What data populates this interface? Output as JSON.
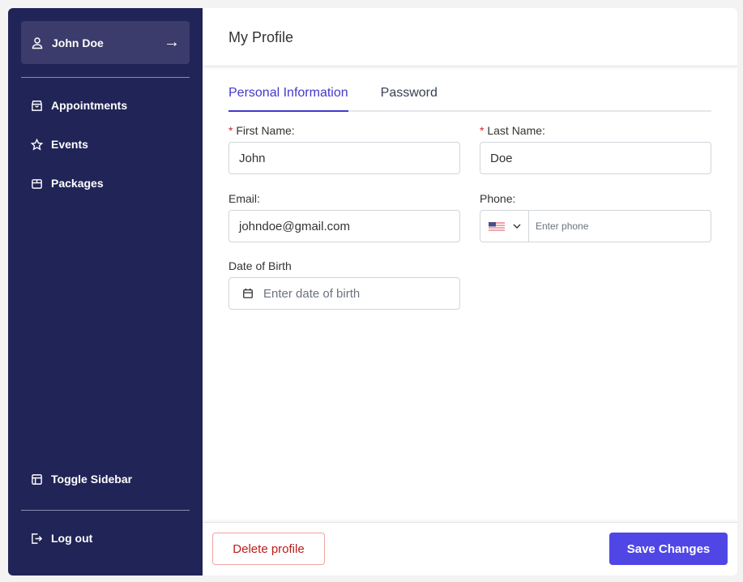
{
  "sidebar": {
    "user": "John Doe",
    "items": [
      {
        "label": "Appointments",
        "icon": "shopping-bag-icon"
      },
      {
        "label": "Events",
        "icon": "star-icon"
      },
      {
        "label": "Packages",
        "icon": "package-icon"
      }
    ],
    "toggle": "Toggle Sidebar",
    "logout": "Log out"
  },
  "header": {
    "title": "My Profile"
  },
  "tabs": [
    {
      "label": "Personal Information",
      "active": true
    },
    {
      "label": "Password",
      "active": false
    }
  ],
  "form": {
    "first_name": {
      "label": "First Name:",
      "value": "John",
      "required": true
    },
    "last_name": {
      "label": "Last Name:",
      "value": "Doe",
      "required": true
    },
    "email": {
      "label": "Email:",
      "value": "johndoe@gmail.com"
    },
    "phone": {
      "label": "Phone:",
      "placeholder": "Enter phone",
      "country": "US"
    },
    "dob": {
      "label": "Date of Birth",
      "placeholder": "Enter date of birth"
    }
  },
  "footer": {
    "delete": "Delete profile",
    "save": "Save Changes"
  },
  "colors": {
    "sidebar": "#212457",
    "accent": "#4f46e5",
    "danger": "#b91c1c"
  }
}
